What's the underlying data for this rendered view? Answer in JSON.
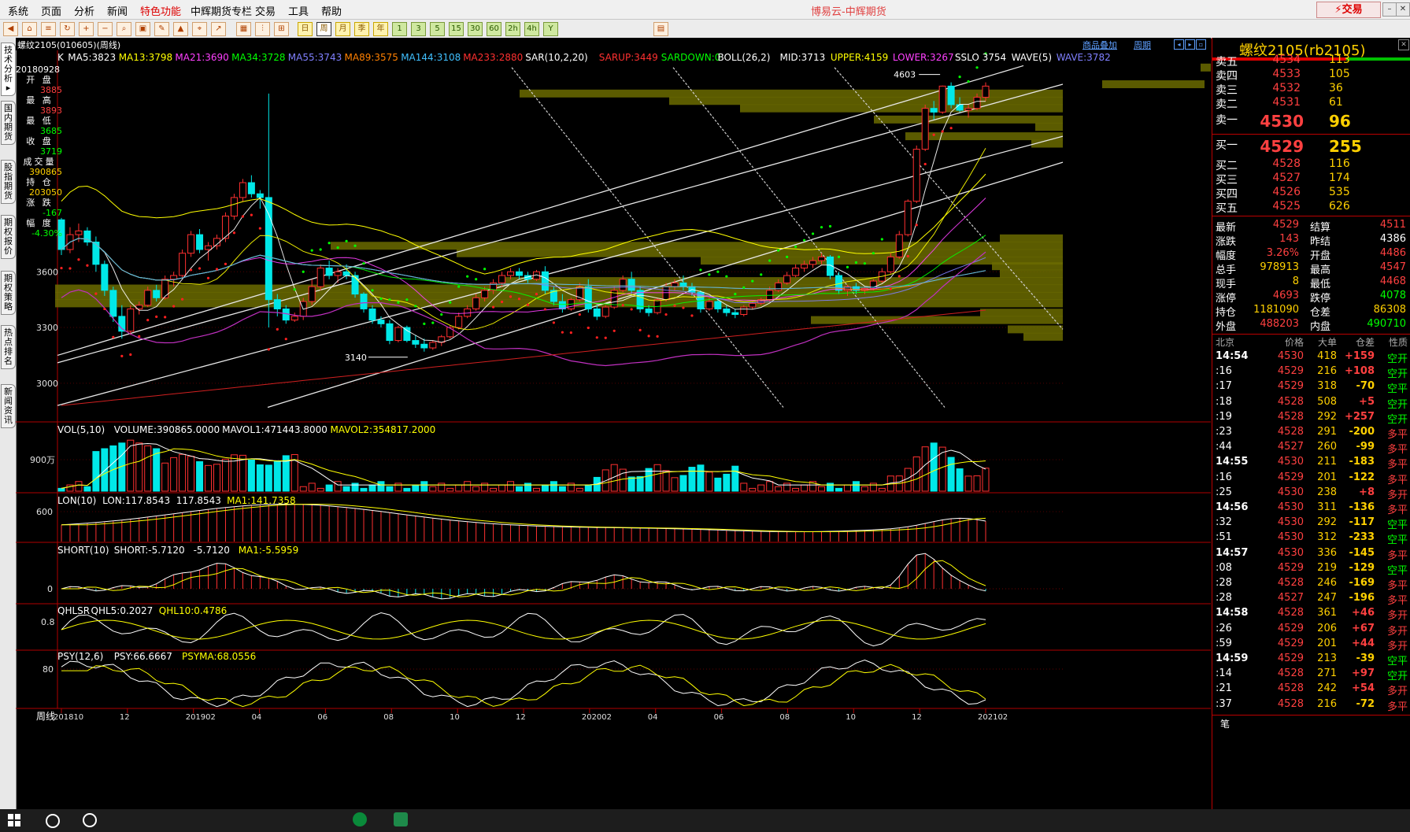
{
  "menu": {
    "items": [
      "系统",
      "页面",
      "分析",
      "新闻",
      "特色功能",
      "中辉期货专栏",
      "交易",
      "工具",
      "帮助"
    ],
    "active_index": 4,
    "app_title": "博易云-中辉期货",
    "trade_button": "交易"
  },
  "toolbar": {
    "periods": [
      "日",
      "周",
      "月",
      "季",
      "年"
    ],
    "active_period": "周",
    "intervals": [
      "1",
      "3",
      "5",
      "15",
      "30",
      "60",
      "2h",
      "4h",
      "Y"
    ]
  },
  "left_tabs": [
    "技术分析",
    "国内期货",
    "股指期货",
    "期权报价",
    "期权策略",
    "热点排名",
    "新闻资讯"
  ],
  "chart": {
    "title": "螺纹2105(010605)(周线)",
    "link_add": "商品叠加",
    "link_period": "周期",
    "ma_line": [
      {
        "text": "K",
        "color": "#ffffff"
      },
      {
        "text": "MA5:3823",
        "color": "#ffffff"
      },
      {
        "text": "MA13:3798",
        "color": "#ffff00"
      },
      {
        "text": "MA21:3690",
        "color": "#ff40ff"
      },
      {
        "text": "MA34:3728",
        "color": "#00ff00"
      },
      {
        "text": "MA55:3743",
        "color": "#8080ff"
      },
      {
        "text": "MA89:3575",
        "color": "#ff8000"
      },
      {
        "text": "MA144:3108",
        "color": "#40c0ff"
      },
      {
        "text": "MA233:2880",
        "color": "#ff3030"
      },
      {
        "text": "SAR(10,2,20)",
        "color": "#ffffff"
      },
      {
        "text": "SARUP:3449",
        "color": "#ff3030"
      },
      {
        "text": "SARDOWN:0",
        "color": "#00ff00"
      },
      {
        "text": "BOLL(26,2)",
        "color": "#ffffff"
      },
      {
        "text": "MID:3713",
        "color": "#ffffff"
      },
      {
        "text": "UPPER:4159",
        "color": "#ffff00"
      },
      {
        "text": "LOWER:3267",
        "color": "#ff40ff"
      },
      {
        "text": "SSLO 3754",
        "color": "#ffffff"
      },
      {
        "text": "WAVE(5)",
        "color": "#ffffff"
      },
      {
        "text": "WAVE:3782",
        "color": "#8080ff"
      }
    ],
    "info_box": {
      "date": "20180928",
      "items": [
        {
          "label": "开 盘",
          "value": "3885",
          "color": "#ff4040"
        },
        {
          "label": "最 高",
          "value": "3893",
          "color": "#ff4040"
        },
        {
          "label": "最 低",
          "value": "3685",
          "color": "#00ff00"
        },
        {
          "label": "收 盘",
          "value": "3719",
          "color": "#00ff00"
        },
        {
          "label": "成交量",
          "value": "390865",
          "color": "#ffd000"
        },
        {
          "label": "持 仓",
          "value": "203050",
          "color": "#ffd000"
        },
        {
          "label": "涨 跌",
          "value": "-167",
          "color": "#00ff00"
        },
        {
          "label": "幅 度",
          "value": "-4.30%",
          "color": "#00ff00"
        }
      ]
    },
    "price_axis": [
      "3600",
      "3300",
      "3000"
    ],
    "marks": {
      "high": "4603",
      "low": "3140"
    },
    "vol_line": [
      {
        "text": "VOL(5,10)",
        "color": "#ffffff"
      },
      {
        "text": "VOLUME:390865.0000",
        "color": "#ffffff"
      },
      {
        "text": "MAVOL1:471443.8000",
        "color": "#ffffff"
      },
      {
        "text": "MAVOL2:354817.2000",
        "color": "#ffff00"
      }
    ],
    "vol_axis": "900万",
    "lon_line": [
      {
        "text": "LON(10)",
        "color": "#ffffff"
      },
      {
        "text": "LON:117.8543",
        "color": "#ffffff"
      },
      {
        "text": "117.8543",
        "color": "#ffffff"
      },
      {
        "text": "MA1:141.7358",
        "color": "#ffff00"
      }
    ],
    "lon_axis": "600",
    "short_line": [
      {
        "text": "SHORT(10)",
        "color": "#ffffff"
      },
      {
        "text": "SHORT:-5.7120",
        "color": "#ffffff"
      },
      {
        "text": "-5.7120",
        "color": "#ffffff"
      },
      {
        "text": "MA1:-5.5959",
        "color": "#ffff00"
      }
    ],
    "short_axis": "0",
    "qhl_line": [
      {
        "text": "QHLSR",
        "color": "#ffffff"
      },
      {
        "text": "QHL5:0.2027",
        "color": "#ffffff"
      },
      {
        "text": "QHL10:0.4786",
        "color": "#ffff00"
      }
    ],
    "qhl_axis": "0.8",
    "psy_line": [
      {
        "text": "PSY(12,6)",
        "color": "#ffffff"
      },
      {
        "text": "PSY:66.6667",
        "color": "#ffffff"
      },
      {
        "text": "PSYMA:68.0556",
        "color": "#ffff00"
      }
    ],
    "psy_axis": "80",
    "time_axis_label": "周线",
    "time_axis": [
      "201810",
      "12",
      "201902",
      "04",
      "06",
      "08",
      "10",
      "12",
      "202002",
      "04",
      "06",
      "08",
      "10",
      "12",
      "202102"
    ]
  },
  "panel": {
    "title": "螺纹2105(rb2105)",
    "asks": [
      {
        "label": "卖五",
        "price": "4534",
        "vol": "113"
      },
      {
        "label": "卖四",
        "price": "4533",
        "vol": "105"
      },
      {
        "label": "卖三",
        "price": "4532",
        "vol": "36"
      },
      {
        "label": "卖二",
        "price": "4531",
        "vol": "61"
      },
      {
        "label": "卖一",
        "price": "4530",
        "vol": "96"
      }
    ],
    "bids": [
      {
        "label": "买一",
        "price": "4529",
        "vol": "255"
      },
      {
        "label": "买二",
        "price": "4528",
        "vol": "116"
      },
      {
        "label": "买三",
        "price": "4527",
        "vol": "174"
      },
      {
        "label": "买四",
        "price": "4526",
        "vol": "535"
      },
      {
        "label": "买五",
        "price": "4525",
        "vol": "626"
      }
    ],
    "stats": [
      {
        "l1": "最新",
        "v1": "4529",
        "c1": "#ff4040",
        "l2": "结算",
        "v2": "4511",
        "c2": "#ff4040"
      },
      {
        "l1": "涨跌",
        "v1": "143",
        "c1": "#ff4040",
        "l2": "昨结",
        "v2": "4386",
        "c2": "#ffffff"
      },
      {
        "l1": "幅度",
        "v1": "3.26%",
        "c1": "#ff4040",
        "l2": "开盘",
        "v2": "4486",
        "c2": "#ff4040"
      },
      {
        "l1": "总手",
        "v1": "978913",
        "c1": "#ffd000",
        "l2": "最高",
        "v2": "4547",
        "c2": "#ff4040"
      },
      {
        "l1": "现手",
        "v1": "8",
        "c1": "#ffd000",
        "l2": "最低",
        "v2": "4468",
        "c2": "#ff4040"
      },
      {
        "l1": "涨停",
        "v1": "4693",
        "c1": "#ff4040",
        "l2": "跌停",
        "v2": "4078",
        "c2": "#00ff00"
      },
      {
        "l1": "持仓",
        "v1": "1181090",
        "c1": "#ffd000",
        "l2": "仓差",
        "v2": "86308",
        "c2": "#ffd000"
      },
      {
        "l1": "外盘",
        "v1": "488203",
        "c1": "#ff4040",
        "l2": "内盘",
        "v2": "490710",
        "c2": "#00ff00"
      }
    ],
    "ticks_header": {
      "time": "北京",
      "price": "价格",
      "vol": "大单",
      "diff": "仓差",
      "nature": "性质"
    },
    "ticks": [
      {
        "t": "14:54",
        "p": "4530",
        "v": "418",
        "c": "+159",
        "n": "空开"
      },
      {
        "t": ":16",
        "p": "4529",
        "v": "216",
        "c": "+108",
        "n": "空开"
      },
      {
        "t": ":17",
        "p": "4529",
        "v": "318",
        "c": "-70",
        "n": "空平"
      },
      {
        "t": ":18",
        "p": "4528",
        "v": "508",
        "c": "+5",
        "n": "空开"
      },
      {
        "t": ":19",
        "p": "4528",
        "v": "292",
        "c": "+257",
        "n": "空开"
      },
      {
        "t": ":23",
        "p": "4528",
        "v": "291",
        "c": "-200",
        "n": "多平"
      },
      {
        "t": ":44",
        "p": "4527",
        "v": "260",
        "c": "-99",
        "n": "多平"
      },
      {
        "t": "14:55",
        "p": "4530",
        "v": "211",
        "c": "-183",
        "n": "多平"
      },
      {
        "t": ":16",
        "p": "4529",
        "v": "201",
        "c": "-122",
        "n": "多平"
      },
      {
        "t": ":25",
        "p": "4530",
        "v": "238",
        "c": "+8",
        "n": "多开"
      },
      {
        "t": "14:56",
        "p": "4530",
        "v": "311",
        "c": "-136",
        "n": "多平"
      },
      {
        "t": ":32",
        "p": "4530",
        "v": "292",
        "c": "-117",
        "n": "空平"
      },
      {
        "t": ":51",
        "p": "4530",
        "v": "312",
        "c": "-233",
        "n": "空平"
      },
      {
        "t": "14:57",
        "p": "4530",
        "v": "336",
        "c": "-145",
        "n": "多平"
      },
      {
        "t": ":08",
        "p": "4529",
        "v": "219",
        "c": "-129",
        "n": "空平"
      },
      {
        "t": ":28",
        "p": "4528",
        "v": "246",
        "c": "-169",
        "n": "多平"
      },
      {
        "t": ":28",
        "p": "4527",
        "v": "247",
        "c": "-196",
        "n": "多平"
      },
      {
        "t": "14:58",
        "p": "4528",
        "v": "361",
        "c": "+46",
        "n": "多开"
      },
      {
        "t": ":26",
        "p": "4529",
        "v": "206",
        "c": "+67",
        "n": "多开"
      },
      {
        "t": ":59",
        "p": "4529",
        "v": "201",
        "c": "+44",
        "n": "多开"
      },
      {
        "t": "14:59",
        "p": "4529",
        "v": "213",
        "c": "-39",
        "n": "空平"
      },
      {
        "t": ":14",
        "p": "4528",
        "v": "271",
        "c": "+97",
        "n": "空开"
      },
      {
        "t": ":21",
        "p": "4528",
        "v": "242",
        "c": "+54",
        "n": "多开"
      },
      {
        "t": ":37",
        "p": "4528",
        "v": "216",
        "c": "-72",
        "n": "多平"
      }
    ],
    "footer_label": "笔"
  }
}
